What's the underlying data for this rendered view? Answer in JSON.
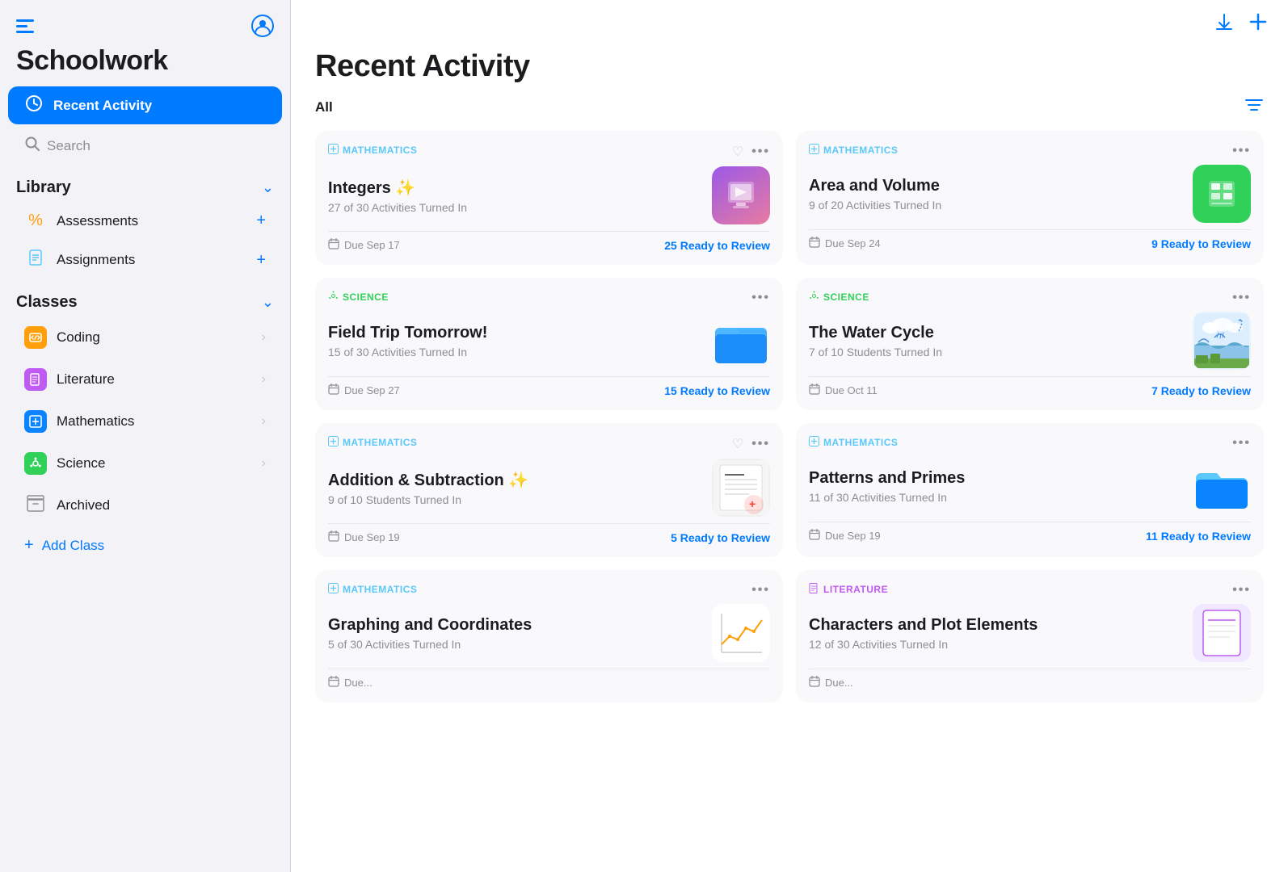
{
  "sidebar": {
    "title": "Schoolwork",
    "nav": {
      "recent_activity": "Recent Activity",
      "search": "Search"
    },
    "library": {
      "title": "Library",
      "items": [
        {
          "id": "assessments",
          "label": "Assessments",
          "icon": "%"
        },
        {
          "id": "assignments",
          "label": "Assignments",
          "icon": "📋"
        }
      ]
    },
    "classes": {
      "title": "Classes",
      "items": [
        {
          "id": "coding",
          "label": "Coding",
          "color": "#ff9f0a"
        },
        {
          "id": "literature",
          "label": "Literature",
          "color": "#bf5af2"
        },
        {
          "id": "mathematics",
          "label": "Mathematics",
          "color": "#0a84ff"
        },
        {
          "id": "science",
          "label": "Science",
          "color": "#30d158"
        }
      ]
    },
    "archived": "Archived",
    "add_class": "Add Class"
  },
  "main": {
    "title": "Recent Activity",
    "filter_label": "All",
    "cards": [
      {
        "subject": "MATHEMATICS",
        "subject_color": "math",
        "title": "Integers ✨",
        "subtitle": "27 of 30 Activities Turned In",
        "due": "Due Sep 17",
        "review": "25 Ready to Review",
        "has_heart": true,
        "thumbnail_type": "keynote"
      },
      {
        "subject": "MATHEMATICS",
        "subject_color": "math",
        "title": "Area and Volume",
        "subtitle": "9 of 20 Activities Turned In",
        "due": "Due Sep 24",
        "review": "9 Ready to Review",
        "has_heart": false,
        "thumbnail_type": "numbers"
      },
      {
        "subject": "SCIENCE",
        "subject_color": "science",
        "title": "Field Trip Tomorrow!",
        "subtitle": "15 of 30 Activities Turned In",
        "due": "Due Sep 27",
        "review": "15 Ready to Review",
        "has_heart": false,
        "thumbnail_type": "folder-blue"
      },
      {
        "subject": "SCIENCE",
        "subject_color": "science",
        "title": "The Water Cycle",
        "subtitle": "7 of 10 Students Turned In",
        "due": "Due Oct 11",
        "review": "7 Ready to Review",
        "has_heart": false,
        "thumbnail_type": "water-cycle"
      },
      {
        "subject": "MATHEMATICS",
        "subject_color": "math",
        "title": "Addition & Subtraction ✨",
        "subtitle": "9 of 10 Students Turned In",
        "due": "Due Sep 19",
        "review": "5 Ready to Review",
        "has_heart": true,
        "thumbnail_type": "math-doc"
      },
      {
        "subject": "MATHEMATICS",
        "subject_color": "math",
        "title": "Patterns and Primes",
        "subtitle": "11 of 30 Activities Turned In",
        "due": "Due Sep 19",
        "review": "11 Ready to Review",
        "has_heart": false,
        "thumbnail_type": "folder-blue2"
      },
      {
        "subject": "MATHEMATICS",
        "subject_color": "math",
        "title": "Graphing and Coordinates",
        "subtitle": "5 of 30 Activities Turned In",
        "due": "Due...",
        "review": "",
        "has_heart": false,
        "thumbnail_type": "graph"
      },
      {
        "subject": "LITERATURE",
        "subject_color": "literature",
        "title": "Characters and Plot Elements",
        "subtitle": "12 of 30 Activities Turned In",
        "due": "Due...",
        "review": "",
        "has_heart": false,
        "thumbnail_type": "lit-doc"
      }
    ]
  }
}
